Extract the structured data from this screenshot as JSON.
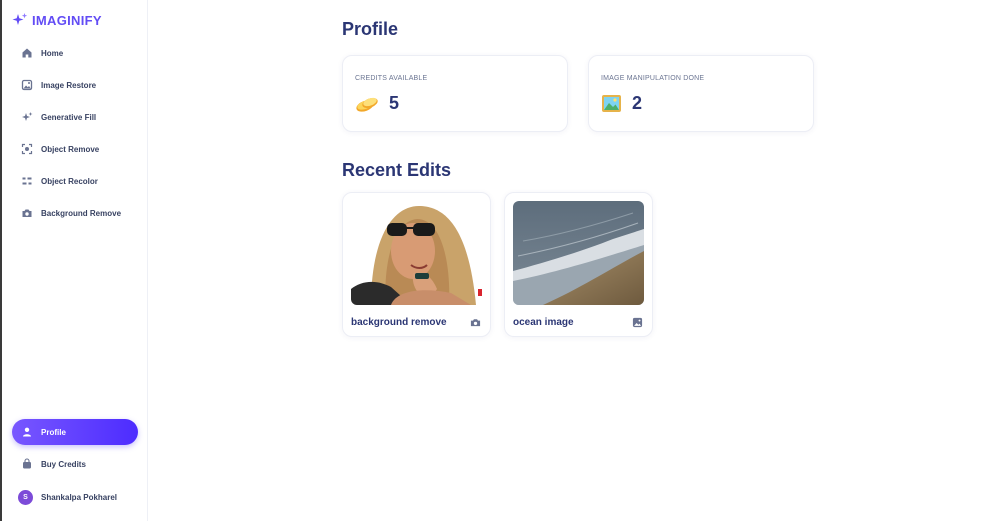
{
  "app": {
    "name": "IMAGINIFY"
  },
  "sidebar": {
    "items": [
      {
        "label": "Home",
        "icon": "home-icon"
      },
      {
        "label": "Image Restore",
        "icon": "image-icon"
      },
      {
        "label": "Generative Fill",
        "icon": "stars-icon"
      },
      {
        "label": "Object Remove",
        "icon": "scan-icon"
      },
      {
        "label": "Object Recolor",
        "icon": "filter-icon"
      },
      {
        "label": "Background Remove",
        "icon": "camera-icon"
      }
    ],
    "bottom": [
      {
        "label": "Profile",
        "icon": "profile-icon",
        "active": true
      },
      {
        "label": "Buy Credits",
        "icon": "bag-icon"
      }
    ],
    "user": {
      "initial": "S",
      "name": "Shankalpa Pokharel"
    }
  },
  "profile": {
    "title": "Profile",
    "stats": [
      {
        "label": "CREDITS AVAILABLE",
        "value": "5",
        "icon": "coins-icon"
      },
      {
        "label": "IMAGE MANIPULATION DONE",
        "value": "2",
        "icon": "photo-icon"
      }
    ]
  },
  "recent": {
    "title": "Recent Edits",
    "items": [
      {
        "title": "background remove",
        "icon": "camera-icon"
      },
      {
        "title": "ocean image",
        "icon": "image-icon"
      }
    ]
  },
  "colors": {
    "accent": "#624cf5",
    "heading": "#2b3674",
    "muted": "#6b7592"
  }
}
